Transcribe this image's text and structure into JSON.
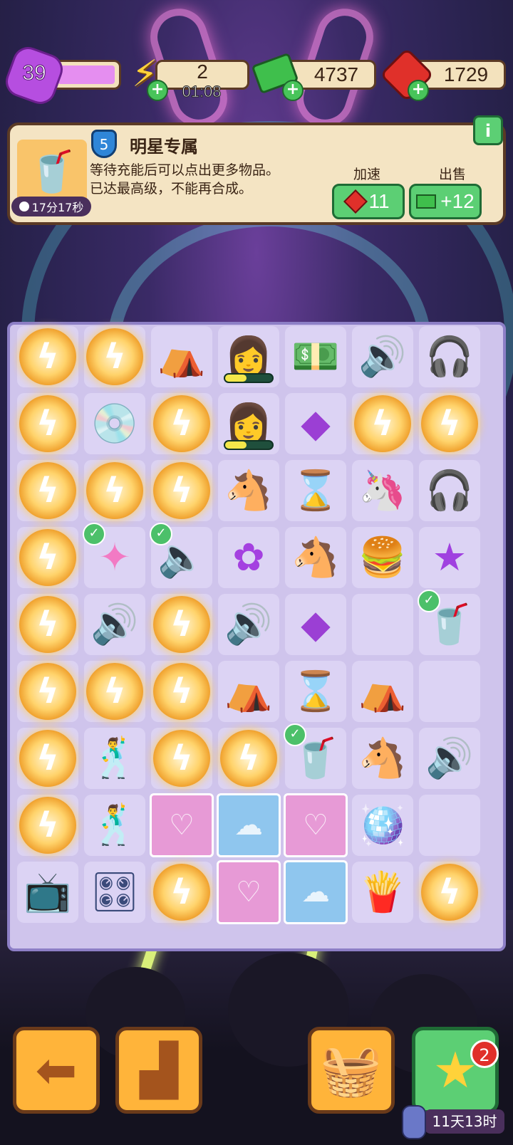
{
  "level": "39",
  "energy": {
    "value": "2",
    "timer": "01:08"
  },
  "cash": "4737",
  "gems": "1729",
  "item": {
    "badge_level": "5",
    "title": "明星专属",
    "desc_line1": "等待充能后可以点出更多物品。",
    "desc_line2": "已达最高级，不能再合成。",
    "timer": "17分17秒",
    "speedup_label": "加速",
    "speedup_cost": "11",
    "sell_label": "出售",
    "sell_value": "+12",
    "info_icon": "i"
  },
  "board": {
    "rows": [
      [
        "charge",
        "charge",
        "tent-icon",
        "idol-girl",
        "cash-stack-icon",
        "speaker-icon",
        "earbuds-icon"
      ],
      [
        "charge",
        "turntable-icon",
        "charge",
        "idol-girl",
        "purple-gem-icon",
        "charge",
        "charge"
      ],
      [
        "charge",
        "charge",
        "charge",
        "pink-pony-icon",
        "hourglass-blue-icon",
        "unicorn-icon",
        "airpods-icon"
      ],
      [
        "charge",
        "glowstick-icon",
        "speakers-pair-icon",
        "purple-blob-icon",
        "pink-pony-icon",
        "burger-fries-icon",
        "purple-star-icon"
      ],
      [
        "charge",
        "speaker-icon",
        "charge",
        "speaker-icon",
        "purple-gem-icon",
        "empty",
        "meal-set-icon"
      ],
      [
        "charge",
        "charge",
        "charge",
        "dome-tent-icon",
        "hourglass-orange-icon",
        "a-frame-tent-icon",
        "empty"
      ],
      [
        "charge",
        "dancer-icon",
        "charge",
        "charge",
        "meal-set-icon",
        "pink-pony-icon",
        "speaker-icon"
      ],
      [
        "charge",
        "dancer-icon",
        "locked-pink",
        "locked-blue",
        "locked-pink",
        "disco-ball-icon",
        "empty"
      ],
      [
        "tv-icon",
        "dj-booth-icon",
        "charge",
        "locked-pink",
        "locked-blue",
        "fries-icon",
        "charge"
      ]
    ]
  },
  "bottom": {
    "badge_count": "2",
    "event_timer": "11天13时"
  }
}
